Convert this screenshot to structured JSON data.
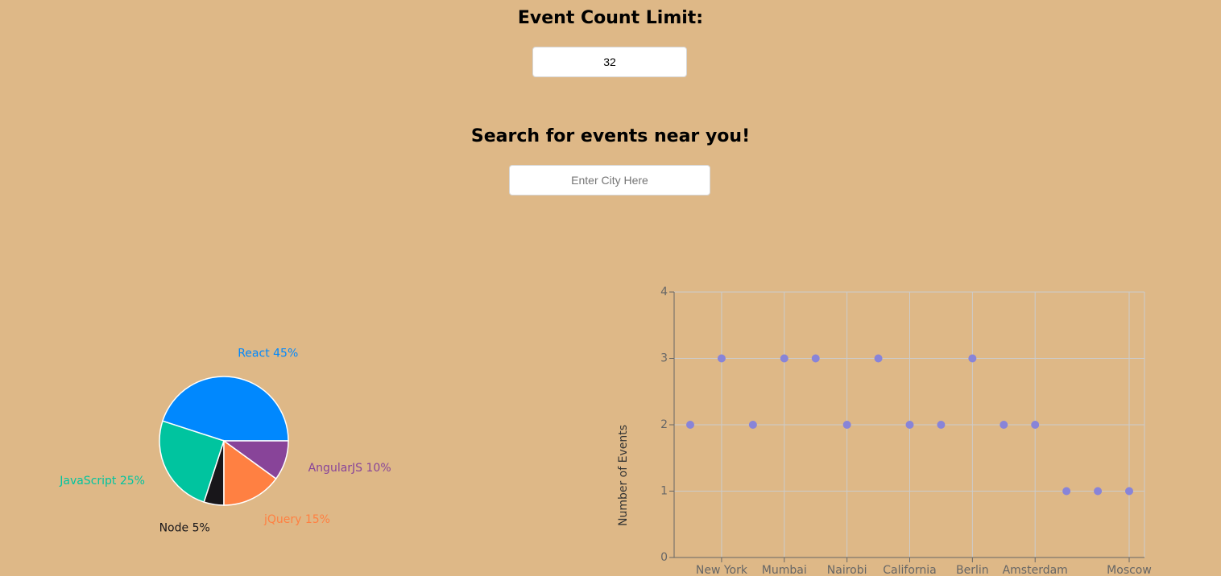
{
  "event_count": {
    "heading": "Event Count Limit:",
    "value": "32"
  },
  "city_search": {
    "heading": "Search for events near you!",
    "placeholder": "Enter City Here",
    "value": ""
  },
  "chart_data": [
    {
      "type": "pie",
      "slices": [
        {
          "label": "React",
          "value": 45,
          "color": "#0088fe"
        },
        {
          "label": "JavaScript",
          "value": 25,
          "color": "#00c49f"
        },
        {
          "label": "Node",
          "value": 5,
          "color": "#18161a"
        },
        {
          "label": "jQuery",
          "value": 15,
          "color": "#ff8042"
        },
        {
          "label": "AngularJS",
          "value": 10,
          "color": "#884499"
        }
      ]
    },
    {
      "type": "scatter",
      "ylabel": "Number of Events",
      "ylim": [
        0,
        4
      ],
      "yticks": [
        0,
        1,
        2,
        3,
        4
      ],
      "x_tick_labels": [
        "",
        "New York",
        "",
        "Mumbai",
        "",
        "Nairobi",
        "",
        "California",
        "",
        "Berlin",
        "",
        "Amsterdam",
        "",
        "",
        "Moscow"
      ],
      "values": [
        2,
        3,
        2,
        3,
        3,
        2,
        3,
        2,
        2,
        3,
        2,
        2,
        1,
        1,
        1
      ],
      "grid": true,
      "point_color": "#8884d8"
    }
  ]
}
